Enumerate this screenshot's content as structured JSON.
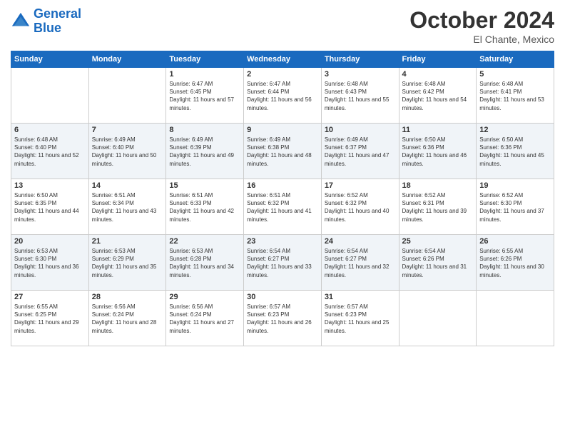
{
  "logo": {
    "line1": "General",
    "line2": "Blue"
  },
  "header": {
    "month": "October 2024",
    "location": "El Chante, Mexico"
  },
  "weekdays": [
    "Sunday",
    "Monday",
    "Tuesday",
    "Wednesday",
    "Thursday",
    "Friday",
    "Saturday"
  ],
  "weeks": [
    [
      {
        "day": "",
        "sunrise": "",
        "sunset": "",
        "daylight": ""
      },
      {
        "day": "",
        "sunrise": "",
        "sunset": "",
        "daylight": ""
      },
      {
        "day": "1",
        "sunrise": "Sunrise: 6:47 AM",
        "sunset": "Sunset: 6:45 PM",
        "daylight": "Daylight: 11 hours and 57 minutes."
      },
      {
        "day": "2",
        "sunrise": "Sunrise: 6:47 AM",
        "sunset": "Sunset: 6:44 PM",
        "daylight": "Daylight: 11 hours and 56 minutes."
      },
      {
        "day": "3",
        "sunrise": "Sunrise: 6:48 AM",
        "sunset": "Sunset: 6:43 PM",
        "daylight": "Daylight: 11 hours and 55 minutes."
      },
      {
        "day": "4",
        "sunrise": "Sunrise: 6:48 AM",
        "sunset": "Sunset: 6:42 PM",
        "daylight": "Daylight: 11 hours and 54 minutes."
      },
      {
        "day": "5",
        "sunrise": "Sunrise: 6:48 AM",
        "sunset": "Sunset: 6:41 PM",
        "daylight": "Daylight: 11 hours and 53 minutes."
      }
    ],
    [
      {
        "day": "6",
        "sunrise": "Sunrise: 6:48 AM",
        "sunset": "Sunset: 6:40 PM",
        "daylight": "Daylight: 11 hours and 52 minutes."
      },
      {
        "day": "7",
        "sunrise": "Sunrise: 6:49 AM",
        "sunset": "Sunset: 6:40 PM",
        "daylight": "Daylight: 11 hours and 50 minutes."
      },
      {
        "day": "8",
        "sunrise": "Sunrise: 6:49 AM",
        "sunset": "Sunset: 6:39 PM",
        "daylight": "Daylight: 11 hours and 49 minutes."
      },
      {
        "day": "9",
        "sunrise": "Sunrise: 6:49 AM",
        "sunset": "Sunset: 6:38 PM",
        "daylight": "Daylight: 11 hours and 48 minutes."
      },
      {
        "day": "10",
        "sunrise": "Sunrise: 6:49 AM",
        "sunset": "Sunset: 6:37 PM",
        "daylight": "Daylight: 11 hours and 47 minutes."
      },
      {
        "day": "11",
        "sunrise": "Sunrise: 6:50 AM",
        "sunset": "Sunset: 6:36 PM",
        "daylight": "Daylight: 11 hours and 46 minutes."
      },
      {
        "day": "12",
        "sunrise": "Sunrise: 6:50 AM",
        "sunset": "Sunset: 6:36 PM",
        "daylight": "Daylight: 11 hours and 45 minutes."
      }
    ],
    [
      {
        "day": "13",
        "sunrise": "Sunrise: 6:50 AM",
        "sunset": "Sunset: 6:35 PM",
        "daylight": "Daylight: 11 hours and 44 minutes."
      },
      {
        "day": "14",
        "sunrise": "Sunrise: 6:51 AM",
        "sunset": "Sunset: 6:34 PM",
        "daylight": "Daylight: 11 hours and 43 minutes."
      },
      {
        "day": "15",
        "sunrise": "Sunrise: 6:51 AM",
        "sunset": "Sunset: 6:33 PM",
        "daylight": "Daylight: 11 hours and 42 minutes."
      },
      {
        "day": "16",
        "sunrise": "Sunrise: 6:51 AM",
        "sunset": "Sunset: 6:32 PM",
        "daylight": "Daylight: 11 hours and 41 minutes."
      },
      {
        "day": "17",
        "sunrise": "Sunrise: 6:52 AM",
        "sunset": "Sunset: 6:32 PM",
        "daylight": "Daylight: 11 hours and 40 minutes."
      },
      {
        "day": "18",
        "sunrise": "Sunrise: 6:52 AM",
        "sunset": "Sunset: 6:31 PM",
        "daylight": "Daylight: 11 hours and 39 minutes."
      },
      {
        "day": "19",
        "sunrise": "Sunrise: 6:52 AM",
        "sunset": "Sunset: 6:30 PM",
        "daylight": "Daylight: 11 hours and 37 minutes."
      }
    ],
    [
      {
        "day": "20",
        "sunrise": "Sunrise: 6:53 AM",
        "sunset": "Sunset: 6:30 PM",
        "daylight": "Daylight: 11 hours and 36 minutes."
      },
      {
        "day": "21",
        "sunrise": "Sunrise: 6:53 AM",
        "sunset": "Sunset: 6:29 PM",
        "daylight": "Daylight: 11 hours and 35 minutes."
      },
      {
        "day": "22",
        "sunrise": "Sunrise: 6:53 AM",
        "sunset": "Sunset: 6:28 PM",
        "daylight": "Daylight: 11 hours and 34 minutes."
      },
      {
        "day": "23",
        "sunrise": "Sunrise: 6:54 AM",
        "sunset": "Sunset: 6:27 PM",
        "daylight": "Daylight: 11 hours and 33 minutes."
      },
      {
        "day": "24",
        "sunrise": "Sunrise: 6:54 AM",
        "sunset": "Sunset: 6:27 PM",
        "daylight": "Daylight: 11 hours and 32 minutes."
      },
      {
        "day": "25",
        "sunrise": "Sunrise: 6:54 AM",
        "sunset": "Sunset: 6:26 PM",
        "daylight": "Daylight: 11 hours and 31 minutes."
      },
      {
        "day": "26",
        "sunrise": "Sunrise: 6:55 AM",
        "sunset": "Sunset: 6:26 PM",
        "daylight": "Daylight: 11 hours and 30 minutes."
      }
    ],
    [
      {
        "day": "27",
        "sunrise": "Sunrise: 6:55 AM",
        "sunset": "Sunset: 6:25 PM",
        "daylight": "Daylight: 11 hours and 29 minutes."
      },
      {
        "day": "28",
        "sunrise": "Sunrise: 6:56 AM",
        "sunset": "Sunset: 6:24 PM",
        "daylight": "Daylight: 11 hours and 28 minutes."
      },
      {
        "day": "29",
        "sunrise": "Sunrise: 6:56 AM",
        "sunset": "Sunset: 6:24 PM",
        "daylight": "Daylight: 11 hours and 27 minutes."
      },
      {
        "day": "30",
        "sunrise": "Sunrise: 6:57 AM",
        "sunset": "Sunset: 6:23 PM",
        "daylight": "Daylight: 11 hours and 26 minutes."
      },
      {
        "day": "31",
        "sunrise": "Sunrise: 6:57 AM",
        "sunset": "Sunset: 6:23 PM",
        "daylight": "Daylight: 11 hours and 25 minutes."
      },
      {
        "day": "",
        "sunrise": "",
        "sunset": "",
        "daylight": ""
      },
      {
        "day": "",
        "sunrise": "",
        "sunset": "",
        "daylight": ""
      }
    ]
  ]
}
